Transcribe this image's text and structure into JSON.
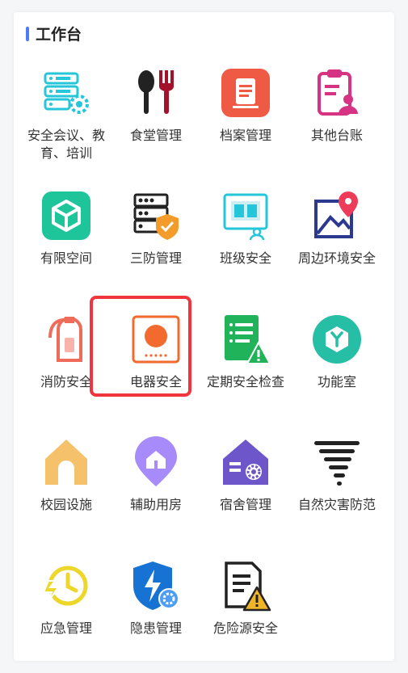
{
  "section": {
    "title": "工作台",
    "accent_color": "#4d7cf6"
  },
  "items": [
    {
      "label": "安全会议、教育、培训",
      "icon": "meeting-server-gear-icon"
    },
    {
      "label": "食堂管理",
      "icon": "spoon-fork-icon"
    },
    {
      "label": "档案管理",
      "icon": "document-file-icon"
    },
    {
      "label": "其他台账",
      "icon": "clipboard-user-icon"
    },
    {
      "label": "有限空间",
      "icon": "cube-box-icon"
    },
    {
      "label": "三防管理",
      "icon": "server-shield-icon"
    },
    {
      "label": "班级安全",
      "icon": "book-people-icon"
    },
    {
      "label": "周边环境安全",
      "icon": "map-pin-icon"
    },
    {
      "label": "消防安全",
      "icon": "fire-extinguisher-icon"
    },
    {
      "label": "电器安全",
      "icon": "electric-panel-icon"
    },
    {
      "label": "定期安全检查",
      "icon": "checklist-warning-icon"
    },
    {
      "label": "功能室",
      "icon": "hexagon-y-icon"
    },
    {
      "label": "校园设施",
      "icon": "school-building-icon"
    },
    {
      "label": "辅助用房",
      "icon": "house-location-icon"
    },
    {
      "label": "宿舍管理",
      "icon": "dorm-house-gear-icon"
    },
    {
      "label": "自然灾害防范",
      "icon": "tornado-icon"
    },
    {
      "label": "应急管理",
      "icon": "clock-lightning-icon"
    },
    {
      "label": "隐患管理",
      "icon": "shield-lightning-gear-icon"
    },
    {
      "label": "危险源安全",
      "icon": "document-warning-icon"
    }
  ],
  "highlight_color": "#f0353c"
}
